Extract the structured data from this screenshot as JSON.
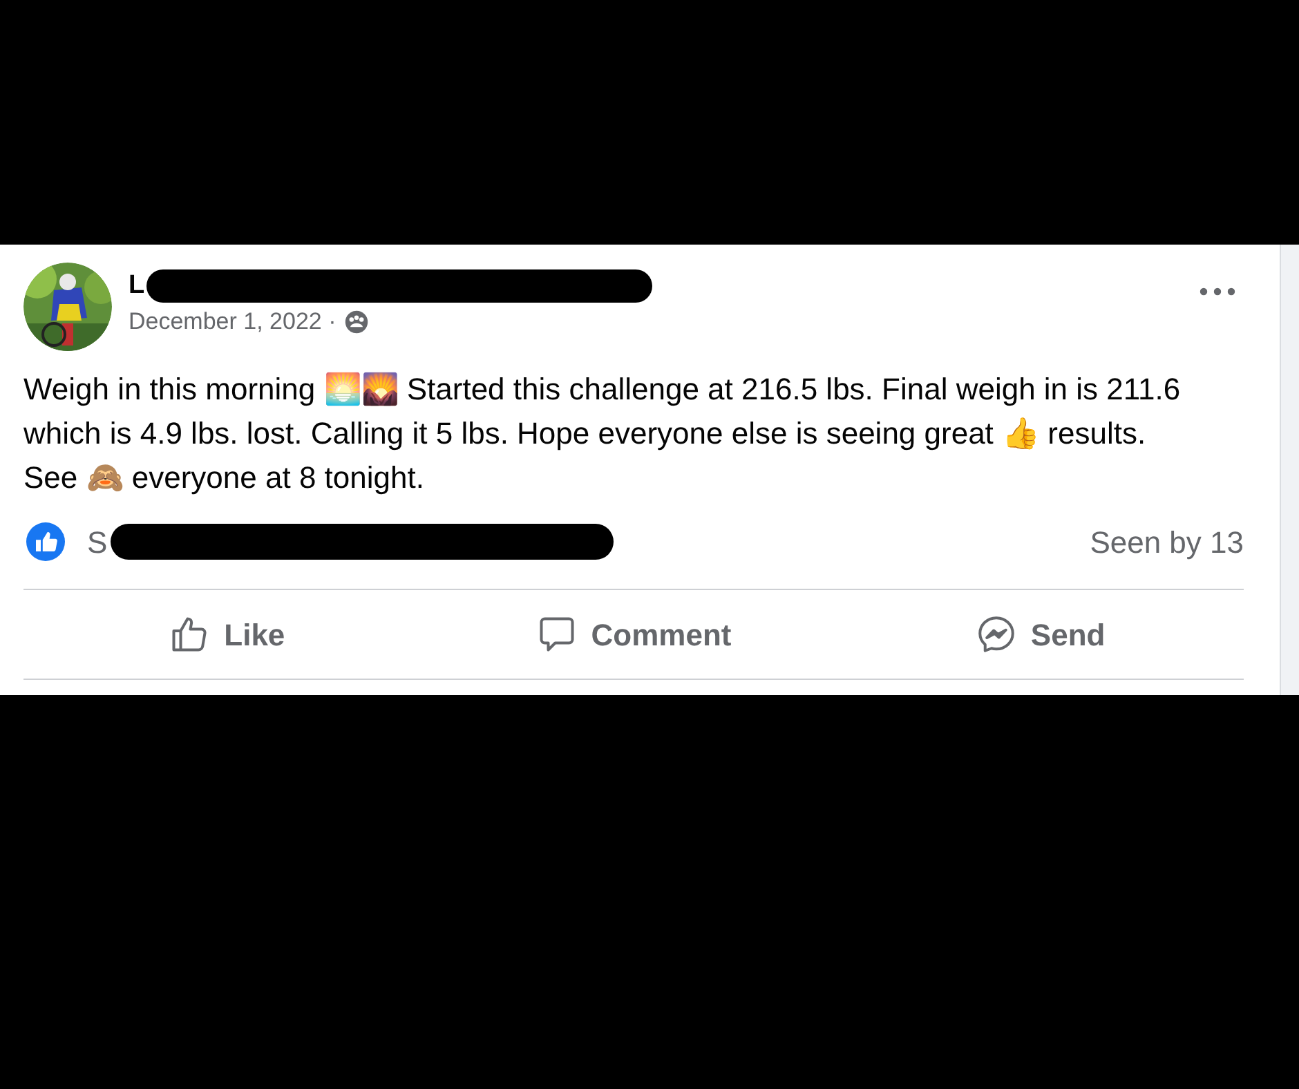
{
  "post": {
    "author_visible": "L",
    "date": "December 1, 2022 ·",
    "text": "Weigh in this morning 🌅🌄 Started this challenge at 216.5 lbs. Final weigh in is 211.6 which is 4.9 lbs. lost. Calling it 5 lbs. Hope everyone else is seeing great 👍 results. See 🙈 everyone at 8 tonight.",
    "likers_visible": "S",
    "seen": "Seen by 13"
  },
  "actions": [
    {
      "kind": "like",
      "label": "Like"
    },
    {
      "kind": "comment",
      "label": "Comment"
    },
    {
      "kind": "send",
      "label": "Send"
    }
  ]
}
